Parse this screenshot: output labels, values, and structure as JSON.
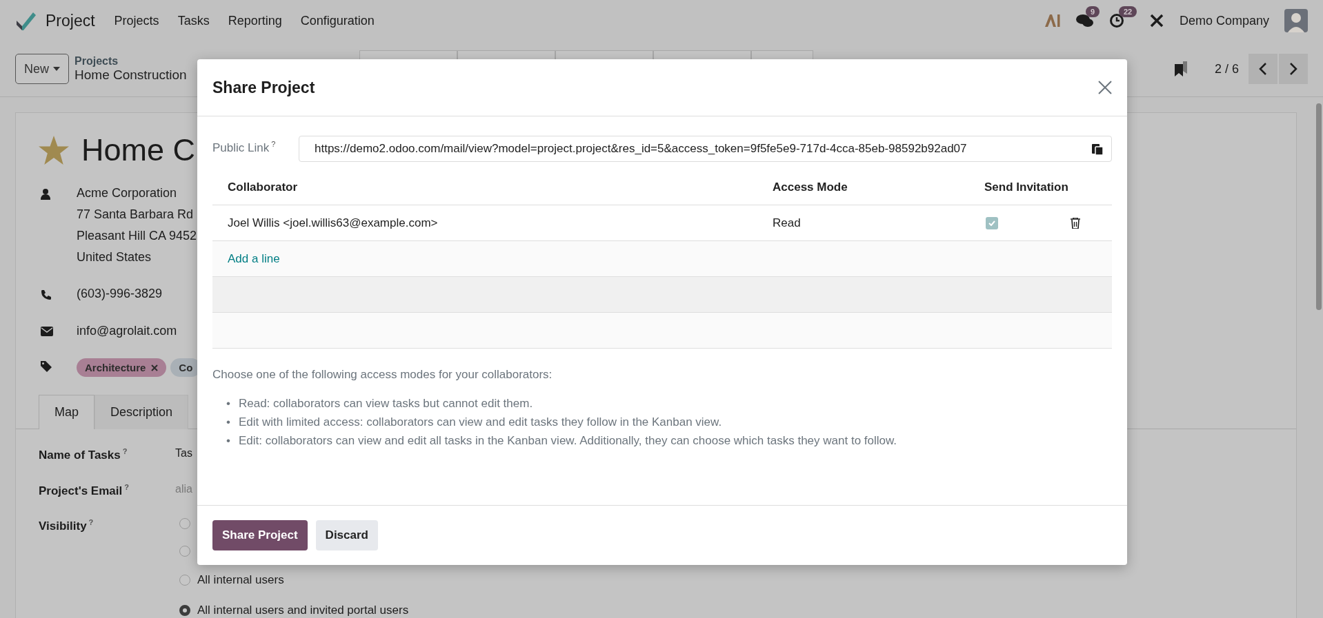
{
  "navbar": {
    "app_name": "Project",
    "menu": [
      "Projects",
      "Tasks",
      "Reporting",
      "Configuration"
    ],
    "chat_badge": "9",
    "activity_badge": "22",
    "company": "Demo Company"
  },
  "control_panel": {
    "new_button": "New",
    "breadcrumbs": [
      "Projects",
      "Home Construction"
    ],
    "pager": "2 / 6"
  },
  "form": {
    "title": "Home C",
    "partner_lines": [
      "Acme Corporation",
      "77 Santa Barbara Rd",
      "Pleasant Hill CA 9452",
      "United States"
    ],
    "phone": "(603)-996-3829",
    "email": "info@agrolait.com",
    "tags": [
      {
        "label": "Architecture",
        "color": "#a87f94"
      },
      {
        "label": "Co",
        "color": "#a9b0b6"
      }
    ],
    "tabs": [
      {
        "label": "Map",
        "selected": true
      },
      {
        "label": "Description",
        "selected": false
      }
    ],
    "fields": [
      {
        "label": "Name of Tasks",
        "help_mark": "?",
        "value": "Tas"
      },
      {
        "label": "Project's Email",
        "help_mark": "?",
        "placeholder": "alia"
      },
      {
        "label": "Visibility",
        "help_mark": "?"
      }
    ],
    "visibility_options": [
      {
        "selected": false
      },
      {
        "selected": false
      },
      {
        "label": "All internal users",
        "selected": false
      },
      {
        "label": "All internal users and invited portal users",
        "selected": true
      }
    ]
  },
  "modal": {
    "title": "Share Project",
    "public_link_label": "Public Link",
    "public_link_help_mark": "?",
    "public_link": "https://demo2.odoo.com/mail/view?model=project.project&res_id=5&access_token=9f5fe5e9-717d-4cca-85eb-98592b92ad07",
    "columns": [
      "Collaborator",
      "Access Mode",
      "Send Invitation"
    ],
    "rows": [
      {
        "collaborator": "Joel Willis <joel.willis63@example.com>",
        "access_mode": "Read",
        "send_invitation": true
      }
    ],
    "add_line": "Add a line",
    "help": "Choose one of the following access modes for your collaborators:",
    "bullets": [
      {
        "marker": "•",
        "text": "Read: collaborators can view tasks but cannot edit them."
      },
      {
        "marker": "•",
        "text": "Edit with limited access: collaborators can view and edit tasks they follow in the Kanban view."
      },
      {
        "marker": "•",
        "text": "Edit: collaborators can view and edit all tasks in the Kanban view. Additionally, they can choose which tasks they want to follow."
      }
    ],
    "buttons": [
      "Share Project",
      "Discard"
    ]
  }
}
